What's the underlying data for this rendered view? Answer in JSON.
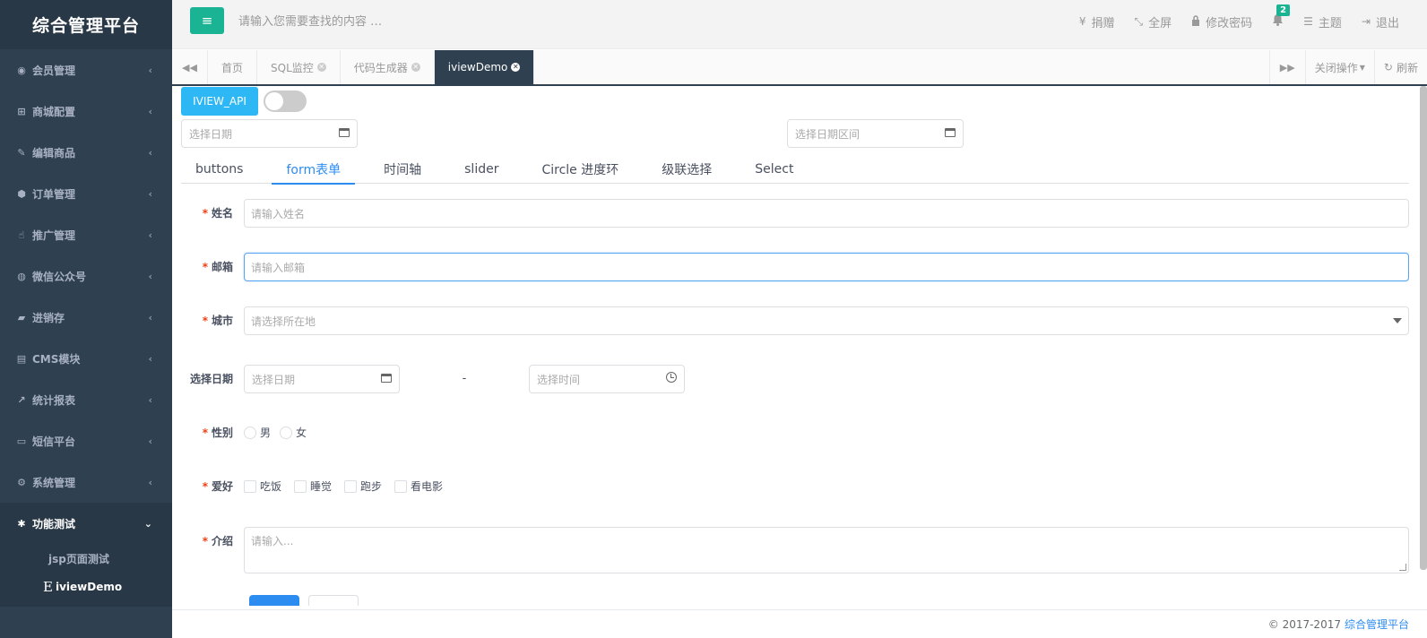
{
  "app": {
    "title": "综合管理平台"
  },
  "sidebar": {
    "items": [
      {
        "label": "会员管理",
        "icon": "user-circle-icon"
      },
      {
        "label": "商城配置",
        "icon": "cart-icon"
      },
      {
        "label": "编辑商品",
        "icon": "edit-icon"
      },
      {
        "label": "订单管理",
        "icon": "cube-icon"
      },
      {
        "label": "推广管理",
        "icon": "hand-icon"
      },
      {
        "label": "微信公众号",
        "icon": "wechat-icon"
      },
      {
        "label": "进销存",
        "icon": "truck-icon"
      },
      {
        "label": "CMS模块",
        "icon": "book-icon"
      },
      {
        "label": "统计报表",
        "icon": "line-chart-icon"
      },
      {
        "label": "短信平台",
        "icon": "desktop-icon"
      },
      {
        "label": "系统管理",
        "icon": "gear-icon"
      }
    ],
    "open_item": {
      "label": "功能测试",
      "icon": "bug-icon"
    },
    "sub_items": [
      {
        "label": "jsp页面测试"
      },
      {
        "label": "iviewDemo",
        "prefix": "E"
      }
    ]
  },
  "header": {
    "search_placeholder": "请输入您需要查找的内容 …",
    "links": [
      {
        "label": "捐赠",
        "icon": "yen-icon",
        "glyph": "¥"
      },
      {
        "label": "全屏",
        "icon": "fullscreen-icon",
        "glyph": "⤡"
      },
      {
        "label": "修改密码",
        "icon": "lock-icon",
        "glyph": "🔒"
      },
      {
        "label": "主题",
        "icon": "theme-icon",
        "glyph": "☰"
      },
      {
        "label": "退出",
        "icon": "logout-icon",
        "glyph": "⇥"
      }
    ],
    "notification_count": "2"
  },
  "tabbar": {
    "tabs": [
      {
        "label": "首页",
        "closable": false
      },
      {
        "label": "SQL监控",
        "closable": true
      },
      {
        "label": "代码生成器",
        "closable": true
      },
      {
        "label": "iviewDemo",
        "closable": true,
        "active": true
      }
    ],
    "close_ops_label": "关闭操作",
    "refresh_label": "刷新"
  },
  "content": {
    "api_button_label": "IVIEW_API",
    "switch_on": false,
    "date_picker_placeholder": "选择日期",
    "date_range_placeholder": "选择日期区间",
    "tabs": [
      "buttons",
      "form表单",
      "时间轴",
      "slider",
      "Circle 进度环",
      "级联选择",
      "Select"
    ],
    "active_tab": "form表单",
    "form": {
      "name": {
        "label": "姓名",
        "placeholder": "请输入姓名"
      },
      "email": {
        "label": "邮箱",
        "placeholder": "请输入邮箱"
      },
      "city": {
        "label": "城市",
        "placeholder": "请选择所在地"
      },
      "date": {
        "label": "选择日期",
        "date_placeholder": "选择日期",
        "separator": "-",
        "time_placeholder": "选择时间"
      },
      "gender": {
        "label": "性别",
        "options": [
          "男",
          "女"
        ]
      },
      "hobby": {
        "label": "爱好",
        "options": [
          "吃饭",
          "睡觉",
          "跑步",
          "看电影"
        ]
      },
      "intro": {
        "label": "介绍",
        "placeholder": "请输入..."
      }
    }
  },
  "footer": {
    "copyright": "© 2017-2017",
    "link": "综合管理平台"
  },
  "colors": {
    "sidebar_bg": "#2f4050",
    "accent": "#1ab394",
    "primary": "#2d8cf0",
    "info": "#2db7f5",
    "required": "#ed3f14"
  }
}
